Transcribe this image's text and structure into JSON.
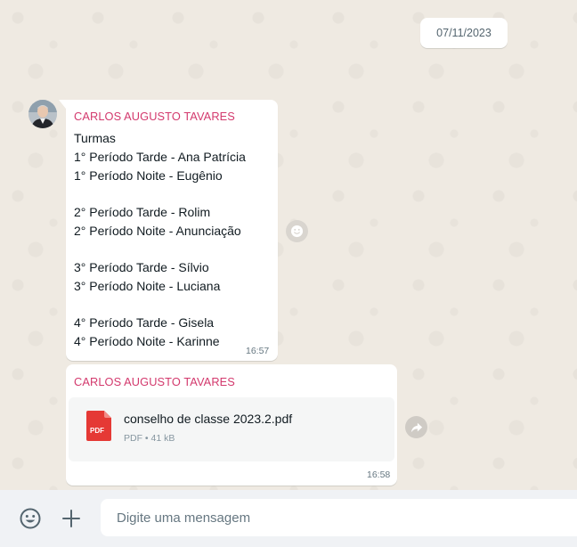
{
  "chat": {
    "date_chip": "07/11/2023",
    "message1": {
      "sender": "CARLOS AUGUSTO TAVARES",
      "lines": [
        "Turmas",
        "1° Período Tarde - Ana Patrícia",
        "1° Período Noite - Eugênio",
        "",
        "2° Período Tarde - Rolim",
        "2° Período Noite - Anunciação",
        "",
        "3° Período Tarde - Sílvio",
        "3° Período Noite - Luciana",
        "",
        "4° Período Tarde - Gisela",
        "4° Período Noite - Karinne"
      ],
      "time": "16:57"
    },
    "message2": {
      "sender": "CARLOS AUGUSTO TAVARES",
      "document": {
        "icon_label": "PDF",
        "file_name": "conselho de classe 2023.2.pdf",
        "meta": "PDF • 41 kB"
      },
      "time": "16:58"
    }
  },
  "composer": {
    "placeholder": "Digite uma mensagem",
    "emoji_icon": "emoji-icon",
    "attach_icon": "plus-icon"
  },
  "colors": {
    "sender_name": "#d3396d",
    "chat_background": "#efeae2",
    "pdf_red": "#e53935"
  }
}
